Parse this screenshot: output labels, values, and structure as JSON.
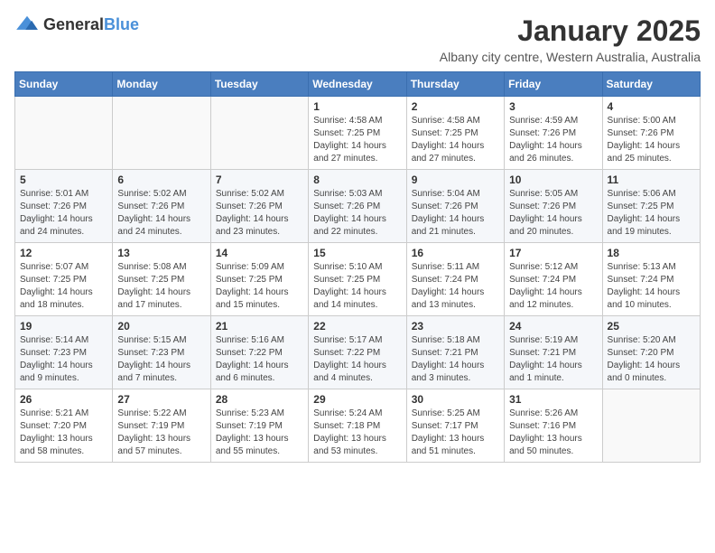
{
  "logo": {
    "general": "General",
    "blue": "Blue"
  },
  "header": {
    "month": "January 2025",
    "location": "Albany city centre, Western Australia, Australia"
  },
  "weekdays": [
    "Sunday",
    "Monday",
    "Tuesday",
    "Wednesday",
    "Thursday",
    "Friday",
    "Saturday"
  ],
  "weeks": [
    [
      {
        "day": "",
        "sunrise": "",
        "sunset": "",
        "daylight": ""
      },
      {
        "day": "",
        "sunrise": "",
        "sunset": "",
        "daylight": ""
      },
      {
        "day": "",
        "sunrise": "",
        "sunset": "",
        "daylight": ""
      },
      {
        "day": "1",
        "sunrise": "Sunrise: 4:58 AM",
        "sunset": "Sunset: 7:25 PM",
        "daylight": "Daylight: 14 hours and 27 minutes."
      },
      {
        "day": "2",
        "sunrise": "Sunrise: 4:58 AM",
        "sunset": "Sunset: 7:25 PM",
        "daylight": "Daylight: 14 hours and 27 minutes."
      },
      {
        "day": "3",
        "sunrise": "Sunrise: 4:59 AM",
        "sunset": "Sunset: 7:26 PM",
        "daylight": "Daylight: 14 hours and 26 minutes."
      },
      {
        "day": "4",
        "sunrise": "Sunrise: 5:00 AM",
        "sunset": "Sunset: 7:26 PM",
        "daylight": "Daylight: 14 hours and 25 minutes."
      }
    ],
    [
      {
        "day": "5",
        "sunrise": "Sunrise: 5:01 AM",
        "sunset": "Sunset: 7:26 PM",
        "daylight": "Daylight: 14 hours and 24 minutes."
      },
      {
        "day": "6",
        "sunrise": "Sunrise: 5:02 AM",
        "sunset": "Sunset: 7:26 PM",
        "daylight": "Daylight: 14 hours and 24 minutes."
      },
      {
        "day": "7",
        "sunrise": "Sunrise: 5:02 AM",
        "sunset": "Sunset: 7:26 PM",
        "daylight": "Daylight: 14 hours and 23 minutes."
      },
      {
        "day": "8",
        "sunrise": "Sunrise: 5:03 AM",
        "sunset": "Sunset: 7:26 PM",
        "daylight": "Daylight: 14 hours and 22 minutes."
      },
      {
        "day": "9",
        "sunrise": "Sunrise: 5:04 AM",
        "sunset": "Sunset: 7:26 PM",
        "daylight": "Daylight: 14 hours and 21 minutes."
      },
      {
        "day": "10",
        "sunrise": "Sunrise: 5:05 AM",
        "sunset": "Sunset: 7:26 PM",
        "daylight": "Daylight: 14 hours and 20 minutes."
      },
      {
        "day": "11",
        "sunrise": "Sunrise: 5:06 AM",
        "sunset": "Sunset: 7:25 PM",
        "daylight": "Daylight: 14 hours and 19 minutes."
      }
    ],
    [
      {
        "day": "12",
        "sunrise": "Sunrise: 5:07 AM",
        "sunset": "Sunset: 7:25 PM",
        "daylight": "Daylight: 14 hours and 18 minutes."
      },
      {
        "day": "13",
        "sunrise": "Sunrise: 5:08 AM",
        "sunset": "Sunset: 7:25 PM",
        "daylight": "Daylight: 14 hours and 17 minutes."
      },
      {
        "day": "14",
        "sunrise": "Sunrise: 5:09 AM",
        "sunset": "Sunset: 7:25 PM",
        "daylight": "Daylight: 14 hours and 15 minutes."
      },
      {
        "day": "15",
        "sunrise": "Sunrise: 5:10 AM",
        "sunset": "Sunset: 7:25 PM",
        "daylight": "Daylight: 14 hours and 14 minutes."
      },
      {
        "day": "16",
        "sunrise": "Sunrise: 5:11 AM",
        "sunset": "Sunset: 7:24 PM",
        "daylight": "Daylight: 14 hours and 13 minutes."
      },
      {
        "day": "17",
        "sunrise": "Sunrise: 5:12 AM",
        "sunset": "Sunset: 7:24 PM",
        "daylight": "Daylight: 14 hours and 12 minutes."
      },
      {
        "day": "18",
        "sunrise": "Sunrise: 5:13 AM",
        "sunset": "Sunset: 7:24 PM",
        "daylight": "Daylight: 14 hours and 10 minutes."
      }
    ],
    [
      {
        "day": "19",
        "sunrise": "Sunrise: 5:14 AM",
        "sunset": "Sunset: 7:23 PM",
        "daylight": "Daylight: 14 hours and 9 minutes."
      },
      {
        "day": "20",
        "sunrise": "Sunrise: 5:15 AM",
        "sunset": "Sunset: 7:23 PM",
        "daylight": "Daylight: 14 hours and 7 minutes."
      },
      {
        "day": "21",
        "sunrise": "Sunrise: 5:16 AM",
        "sunset": "Sunset: 7:22 PM",
        "daylight": "Daylight: 14 hours and 6 minutes."
      },
      {
        "day": "22",
        "sunrise": "Sunrise: 5:17 AM",
        "sunset": "Sunset: 7:22 PM",
        "daylight": "Daylight: 14 hours and 4 minutes."
      },
      {
        "day": "23",
        "sunrise": "Sunrise: 5:18 AM",
        "sunset": "Sunset: 7:21 PM",
        "daylight": "Daylight: 14 hours and 3 minutes."
      },
      {
        "day": "24",
        "sunrise": "Sunrise: 5:19 AM",
        "sunset": "Sunset: 7:21 PM",
        "daylight": "Daylight: 14 hours and 1 minute."
      },
      {
        "day": "25",
        "sunrise": "Sunrise: 5:20 AM",
        "sunset": "Sunset: 7:20 PM",
        "daylight": "Daylight: 14 hours and 0 minutes."
      }
    ],
    [
      {
        "day": "26",
        "sunrise": "Sunrise: 5:21 AM",
        "sunset": "Sunset: 7:20 PM",
        "daylight": "Daylight: 13 hours and 58 minutes."
      },
      {
        "day": "27",
        "sunrise": "Sunrise: 5:22 AM",
        "sunset": "Sunset: 7:19 PM",
        "daylight": "Daylight: 13 hours and 57 minutes."
      },
      {
        "day": "28",
        "sunrise": "Sunrise: 5:23 AM",
        "sunset": "Sunset: 7:19 PM",
        "daylight": "Daylight: 13 hours and 55 minutes."
      },
      {
        "day": "29",
        "sunrise": "Sunrise: 5:24 AM",
        "sunset": "Sunset: 7:18 PM",
        "daylight": "Daylight: 13 hours and 53 minutes."
      },
      {
        "day": "30",
        "sunrise": "Sunrise: 5:25 AM",
        "sunset": "Sunset: 7:17 PM",
        "daylight": "Daylight: 13 hours and 51 minutes."
      },
      {
        "day": "31",
        "sunrise": "Sunrise: 5:26 AM",
        "sunset": "Sunset: 7:16 PM",
        "daylight": "Daylight: 13 hours and 50 minutes."
      },
      {
        "day": "",
        "sunrise": "",
        "sunset": "",
        "daylight": ""
      }
    ]
  ]
}
